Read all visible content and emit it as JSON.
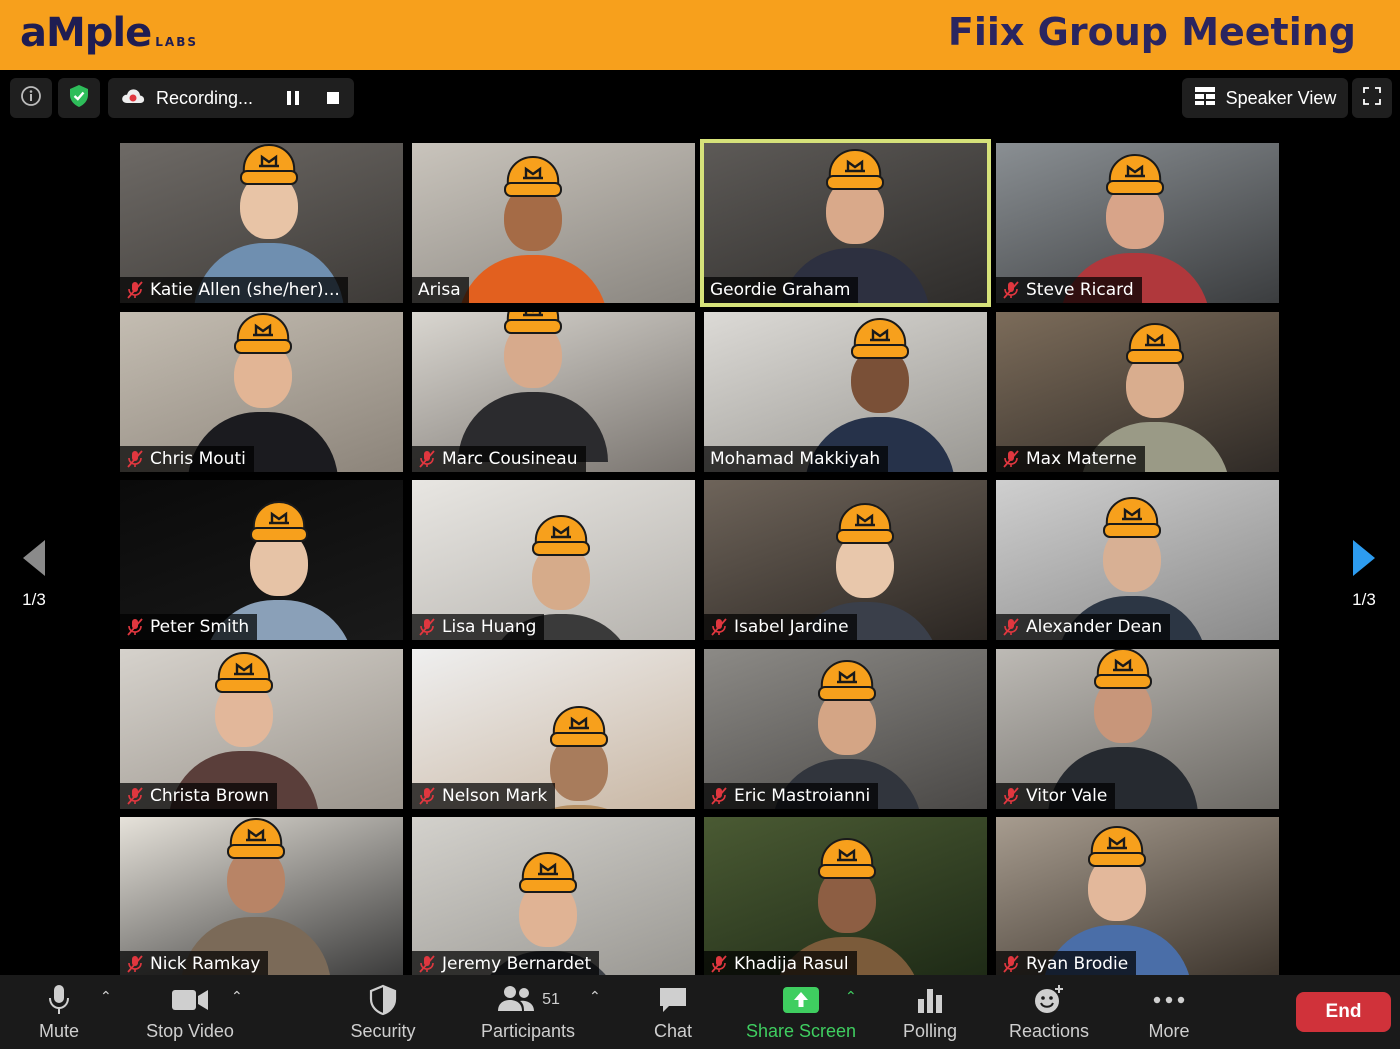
{
  "banner": {
    "logo_main": "aMple",
    "logo_sub": "LABS",
    "title": "Fiix Group Meeting",
    "bg_color": "#f7a01c",
    "text_color": "#2a2560"
  },
  "topbar": {
    "recording_label": "Recording...",
    "speaker_view_label": "Speaker View"
  },
  "pager": {
    "left_page": "1/3",
    "right_page": "1/3"
  },
  "participants": [
    {
      "name": "Katie Allen (she/her)...",
      "muted": true,
      "active": false
    },
    {
      "name": "Arisa",
      "muted": false,
      "active": false
    },
    {
      "name": "Geordie Graham",
      "muted": false,
      "active": true
    },
    {
      "name": "Steve Ricard",
      "muted": true,
      "active": false
    },
    {
      "name": "Chris Mouti",
      "muted": true,
      "active": false
    },
    {
      "name": "Marc Cousineau",
      "muted": true,
      "active": false
    },
    {
      "name": "Mohamad Makkiyah",
      "muted": false,
      "active": false
    },
    {
      "name": "Max Materne",
      "muted": true,
      "active": false
    },
    {
      "name": "Peter Smith",
      "muted": true,
      "active": false
    },
    {
      "name": "Lisa Huang",
      "muted": true,
      "active": false
    },
    {
      "name": "Isabel Jardine",
      "muted": true,
      "active": false
    },
    {
      "name": "Alexander Dean",
      "muted": true,
      "active": false
    },
    {
      "name": "Christa Brown",
      "muted": true,
      "active": false
    },
    {
      "name": "Nelson Mark",
      "muted": true,
      "active": false
    },
    {
      "name": "Eric Mastroianni",
      "muted": true,
      "active": false
    },
    {
      "name": "Vitor Vale",
      "muted": true,
      "active": false
    },
    {
      "name": "Nick Ramkay",
      "muted": true,
      "active": false
    },
    {
      "name": "Jeremy Bernardet",
      "muted": true,
      "active": false
    },
    {
      "name": "Khadija Rasul",
      "muted": true,
      "active": false
    },
    {
      "name": "Ryan Brodie",
      "muted": true,
      "active": false
    }
  ],
  "bottombar": {
    "mute_label": "Mute",
    "stop_video_label": "Stop Video",
    "security_label": "Security",
    "participants_label": "Participants",
    "participants_count": "51",
    "chat_label": "Chat",
    "share_screen_label": "Share Screen",
    "polling_label": "Polling",
    "reactions_label": "Reactions",
    "more_label": "More",
    "end_label": "End"
  },
  "colors": {
    "accent_green": "#3fce60",
    "end_red": "#d0323a",
    "active_speaker_border": "#d6e27a",
    "hat_orange": "#f7a01c",
    "pager_blue": "#2d9cf0"
  },
  "icons": {
    "info": "info-icon",
    "security_shield": "shield-check-icon",
    "cloud_recording": "cloud-icon",
    "pause": "pause-icon",
    "stop": "stop-icon",
    "speaker_view": "grid-icon",
    "fullscreen": "fullscreen-icon",
    "muted": "mic-muted-icon",
    "prev": "arrow-left-icon",
    "next": "arrow-right-icon"
  }
}
